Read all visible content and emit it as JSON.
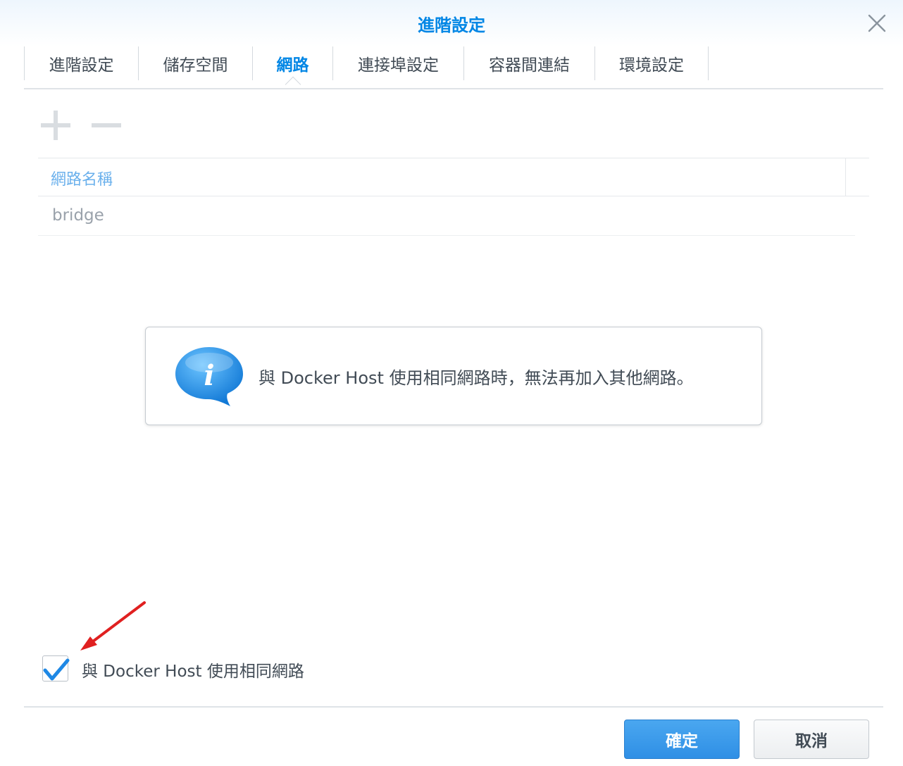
{
  "dialog": {
    "title": "進階設定",
    "close_icon": "close-icon"
  },
  "tabs": [
    {
      "label": "進階設定",
      "active": false
    },
    {
      "label": "儲存空間",
      "active": false
    },
    {
      "label": "網路",
      "active": true
    },
    {
      "label": "連接埠設定",
      "active": false
    },
    {
      "label": "容器間連結",
      "active": false
    },
    {
      "label": "環境設定",
      "active": false
    }
  ],
  "toolbar": {
    "add_icon": "plus-icon",
    "remove_icon": "minus-icon",
    "enabled": false
  },
  "network_table": {
    "columns": [
      "網路名稱"
    ],
    "rows": [
      [
        "bridge"
      ]
    ]
  },
  "info_message": {
    "icon": "info-speech-bubble-icon",
    "text": "與 Docker Host 使用相同網路時，無法再加入其他網路。"
  },
  "host_network_option": {
    "label": "與 Docker Host 使用相同網路",
    "checked": true
  },
  "annotation": {
    "icon": "red-arrow-icon",
    "color": "#e02020"
  },
  "buttons": {
    "ok_label": "確定",
    "cancel_label": "取消"
  },
  "colors": {
    "accent": "#0086e5",
    "primary_button": "#2f8fe5",
    "header_text": "#6ab0ec"
  }
}
